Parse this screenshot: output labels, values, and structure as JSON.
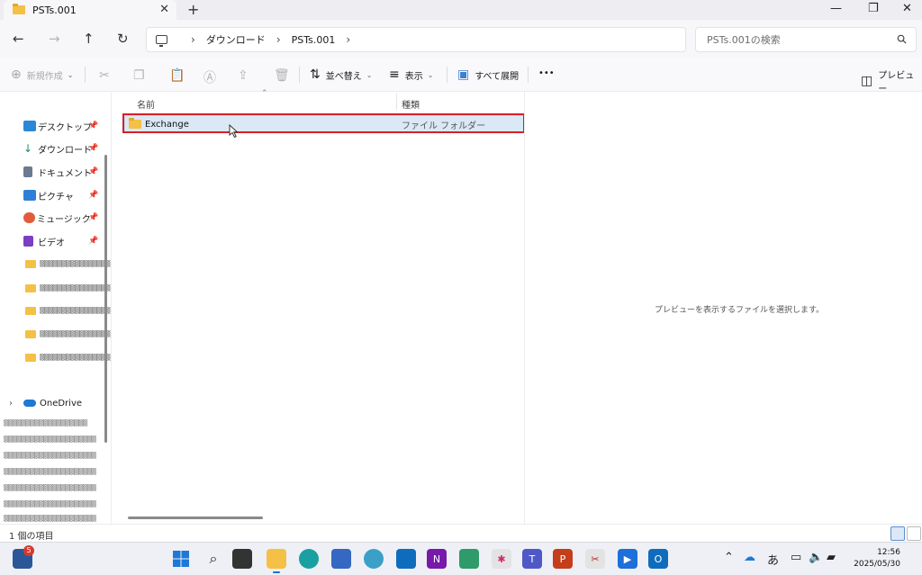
{
  "window": {
    "tab_title": "PSTs.001",
    "tab_close": "✕",
    "new_tab": "+",
    "minimize": "—",
    "maximize": "❐",
    "close": "✕"
  },
  "nav": {
    "back": "←",
    "forward": "→",
    "up": "↑",
    "refresh": "↻"
  },
  "address": {
    "crumbs": [
      "ダウンロード",
      "PSTs.001"
    ]
  },
  "search": {
    "placeholder": "PSTs.001の検索"
  },
  "commands": {
    "new": "新規作成",
    "sort": "並べ替え",
    "view": "表示",
    "expand_all": "すべて展開",
    "more": "•••",
    "preview": "プレビュー"
  },
  "sidebar": {
    "items": [
      {
        "label": "デスクトップ",
        "icon": "desktop-icon",
        "color": "#2b88d8"
      },
      {
        "label": "ダウンロード",
        "icon": "download-icon",
        "color": "#1f8f5f"
      },
      {
        "label": "ドキュメント",
        "icon": "document-icon",
        "color": "#6b7a90"
      },
      {
        "label": "ピクチャ",
        "icon": "pictures-icon",
        "color": "#2f7fd8"
      },
      {
        "label": "ミュージック",
        "icon": "music-icon",
        "color": "#e25b3c"
      },
      {
        "label": "ビデオ",
        "icon": "video-icon",
        "color": "#7a3fc4"
      }
    ],
    "onedrive": "OneDrive"
  },
  "columns": {
    "name": "名前",
    "type": "種類"
  },
  "files": [
    {
      "name": "Exchange",
      "type": "ファイル フォルダー"
    }
  ],
  "preview": {
    "message": "プレビューを表示するファイルを選択します。"
  },
  "status": {
    "item_count": "1 個の項目"
  },
  "taskbar": {
    "mail_badge": "5",
    "ime": "あ",
    "time": "12:56",
    "date": "2025/05/30"
  }
}
